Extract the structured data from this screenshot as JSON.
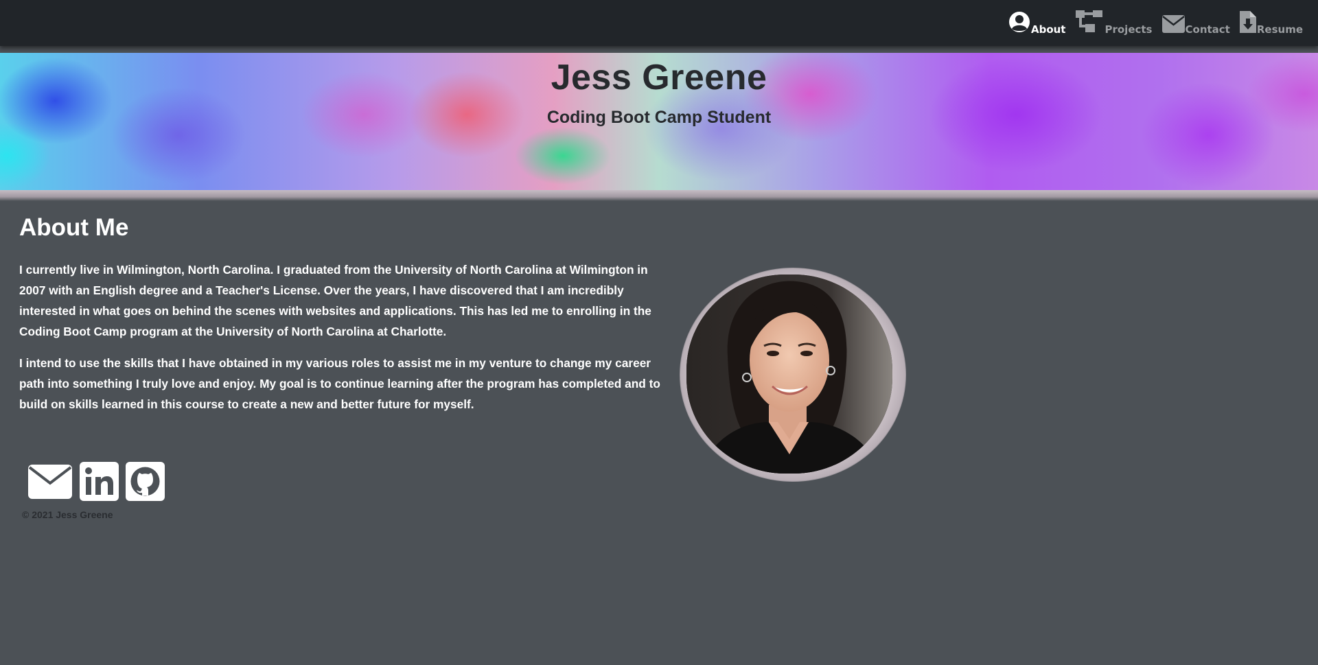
{
  "nav": {
    "items": [
      {
        "label": "About",
        "icon": "user-circle-icon",
        "active": true
      },
      {
        "label": "Projects",
        "icon": "sitemap-icon",
        "active": false
      },
      {
        "label": "Contact",
        "icon": "envelope-icon",
        "active": false
      },
      {
        "label": "Resume",
        "icon": "file-download-icon",
        "active": false
      }
    ]
  },
  "hero": {
    "name": "Jess Greene",
    "subtitle": "Coding Boot Camp Student"
  },
  "about": {
    "heading": "About Me",
    "paragraphs": [
      "I currently live in Wilmington, North Carolina. I graduated from the University of North Carolina at Wilmington in 2007 with an English degree and a Teacher's License. Over the years, I have discovered that I am incredibly interested in what goes on behind the scenes with websites and applications. This has led me to enrolling in the Coding Boot Camp program at the University of North Carolina at Charlotte.",
      "I intend to use the skills that I have obtained in my various roles to assist me in my venture to change my career path into something I truly love and enjoy. My goal is to continue learning after the program has completed and to build on skills learned in this course to create a new and better future for myself."
    ]
  },
  "social": {
    "icons": [
      "envelope-icon",
      "linkedin-icon",
      "github-icon"
    ]
  },
  "footer": {
    "copyright": "© 2021 Jess Greene"
  },
  "colors": {
    "navbar_bg": "#212529",
    "page_bg": "#4c5156",
    "nav_active": "#ffffff",
    "nav_inactive": "#9a9da0"
  }
}
